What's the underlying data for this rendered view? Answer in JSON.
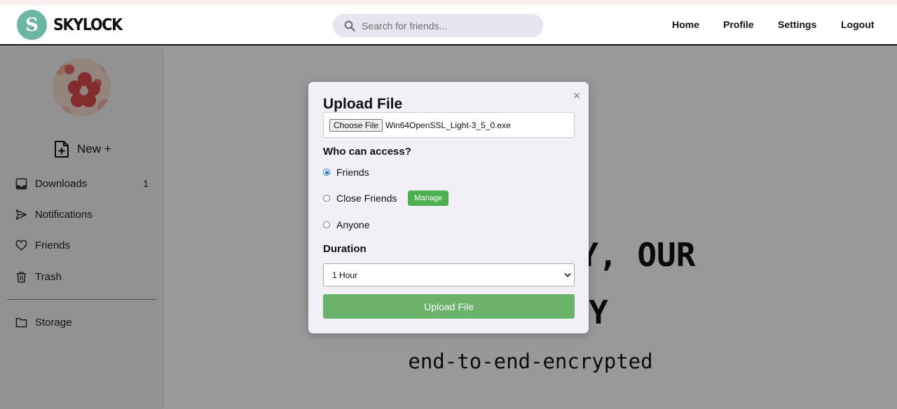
{
  "nav": {
    "logo_letter": "S",
    "brand": "SKYLOCK",
    "search_placeholder": "Search for friends...",
    "links": [
      "Home",
      "Profile",
      "Settings",
      "Logout"
    ]
  },
  "sidebar": {
    "new_label": "New +",
    "items": [
      {
        "label": "Downloads",
        "icon": "inbox-icon",
        "count": "1"
      },
      {
        "label": "Notifications",
        "icon": "send-icon",
        "count": ""
      },
      {
        "label": "Friends",
        "icon": "heart-icon",
        "count": ""
      },
      {
        "label": "Trash",
        "icon": "trash-icon",
        "count": ""
      },
      {
        "label": "Storage",
        "icon": "folder-icon",
        "count": ""
      }
    ]
  },
  "hero": {
    "title_line1": "YOUR PRIVACY, OUR",
    "title_line2": "PRIORITY",
    "subtitle": "end-to-end-encrypted"
  },
  "modal": {
    "title": "Upload File",
    "close": "×",
    "choose_label": "Choose File",
    "file_name": "Win64OpenSSL_Light-3_5_0.exe",
    "access_label": "Who can access?",
    "options": [
      "Friends",
      "Close Friends",
      "Anyone"
    ],
    "selected_option": "Friends",
    "manage_label": "Manage",
    "duration_label": "Duration",
    "duration_value": "1 Hour",
    "submit_label": "Upload File"
  },
  "colors": {
    "accent_teal": "#6bb5a4",
    "button_green": "#4caf50",
    "upload_green": "#6bb26b",
    "modal_bg": "#f3eff7"
  }
}
